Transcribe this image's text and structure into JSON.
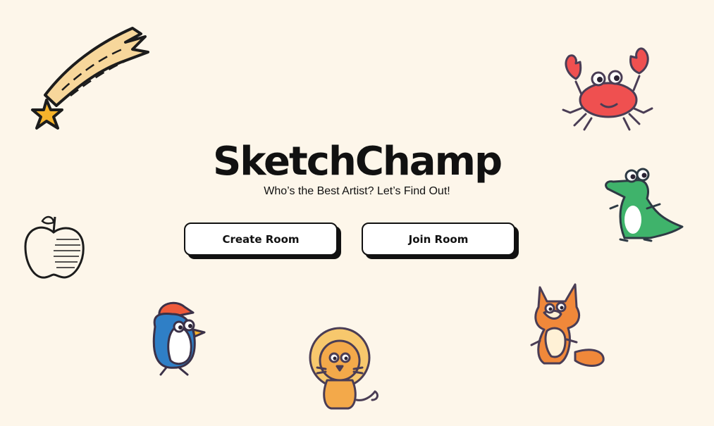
{
  "app": {
    "title": "SketchChamp",
    "subtitle": "Who’s the Best Artist? Let’s Find Out!"
  },
  "actions": {
    "create_label": "Create Room",
    "join_label": "Join Room"
  },
  "illustrations": [
    "shooting-star",
    "crab",
    "apple",
    "crocodile",
    "penguin",
    "lion",
    "fox"
  ],
  "colors": {
    "background": "#fdf6ea",
    "text": "#111111",
    "button_bg": "#ffffff",
    "button_border": "#111111"
  }
}
